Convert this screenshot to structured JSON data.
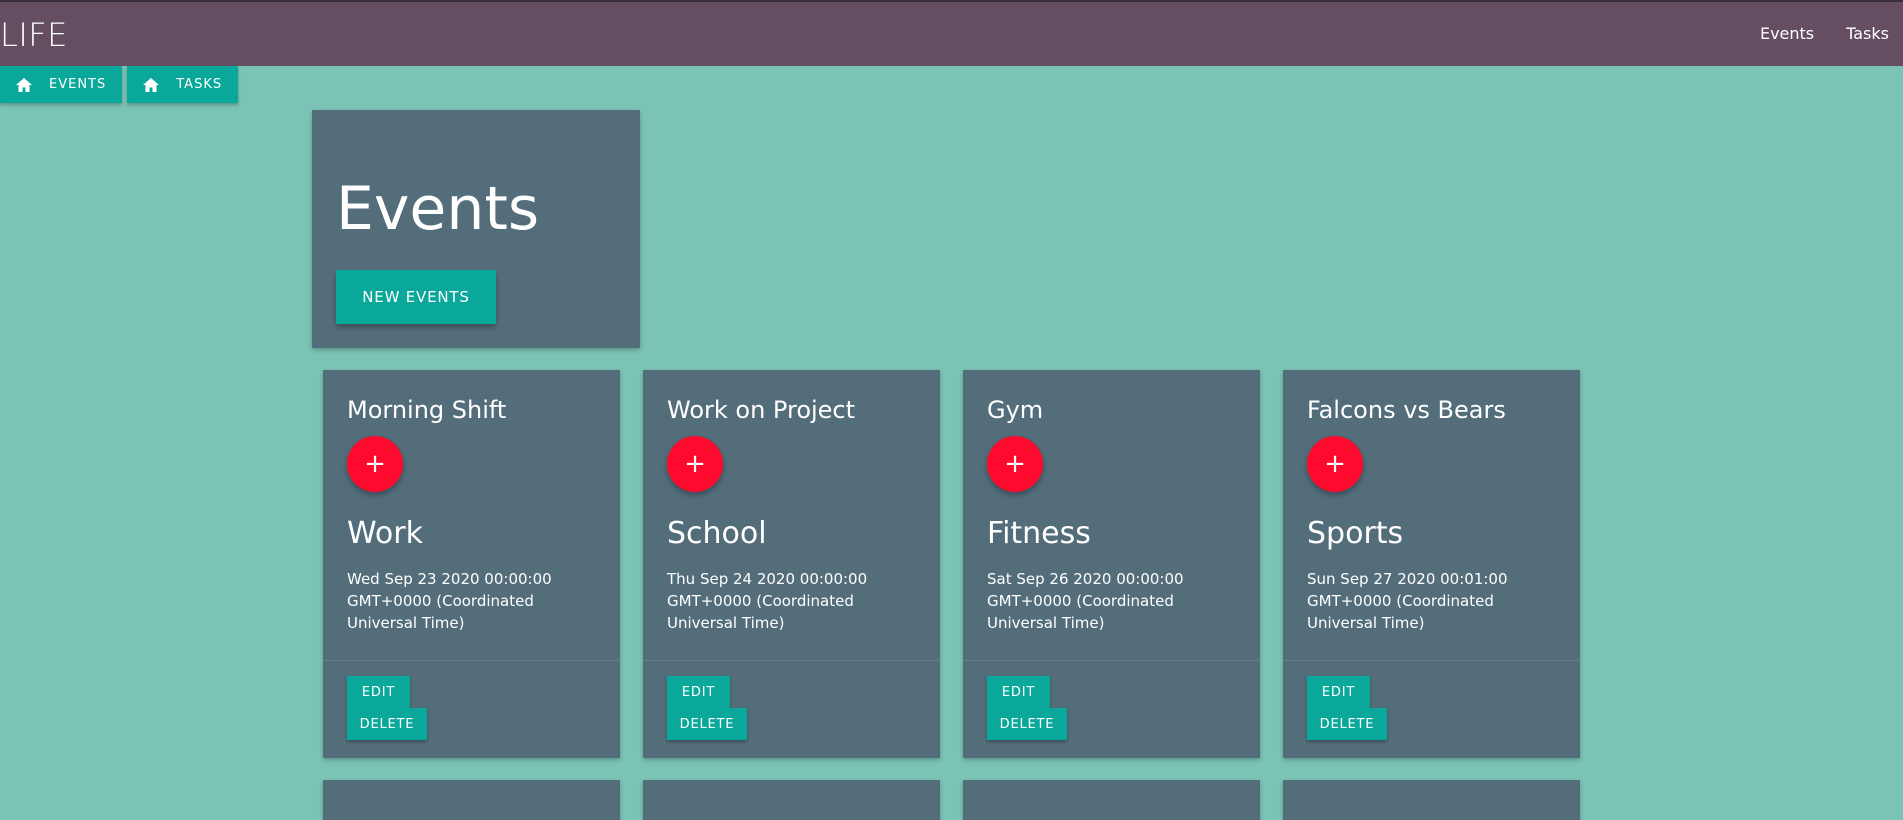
{
  "header": {
    "brand": "LIFE",
    "nav": [
      "Events",
      "Tasks"
    ]
  },
  "tabs": [
    {
      "label": "EVENTS",
      "icon": "home-icon"
    },
    {
      "label": "TASKS",
      "icon": "home-icon"
    }
  ],
  "hero": {
    "title": "Events",
    "new_button": "NEW EVENTS"
  },
  "cards": [
    {
      "title": "Morning Shift",
      "category": "Work",
      "date": "Wed Sep 23 2020 00:00:00 GMT+0000 (Coordinated Universal Time)",
      "edit": "EDIT",
      "delete": "DELETE",
      "fab": "+"
    },
    {
      "title": "Work on Project",
      "category": "School",
      "date": "Thu Sep 24 2020 00:00:00 GMT+0000 (Coordinated Universal Time)",
      "edit": "EDIT",
      "delete": "DELETE",
      "fab": "+"
    },
    {
      "title": "Gym",
      "category": "Fitness",
      "date": "Sat Sep 26 2020 00:00:00 GMT+0000 (Coordinated Universal Time)",
      "edit": "EDIT",
      "delete": "DELETE",
      "fab": "+"
    },
    {
      "title": "Falcons vs Bears",
      "category": "Sports",
      "date": "Sun Sep 27 2020 00:01:00 GMT+0000 (Coordinated Universal Time)",
      "edit": "EDIT",
      "delete": "DELETE",
      "fab": "+"
    }
  ],
  "colors": {
    "background": "#7bc3b4",
    "header": "#654e62",
    "card": "#536d7a",
    "accent": "#0aa89b",
    "fab": "#ff0a2f"
  }
}
